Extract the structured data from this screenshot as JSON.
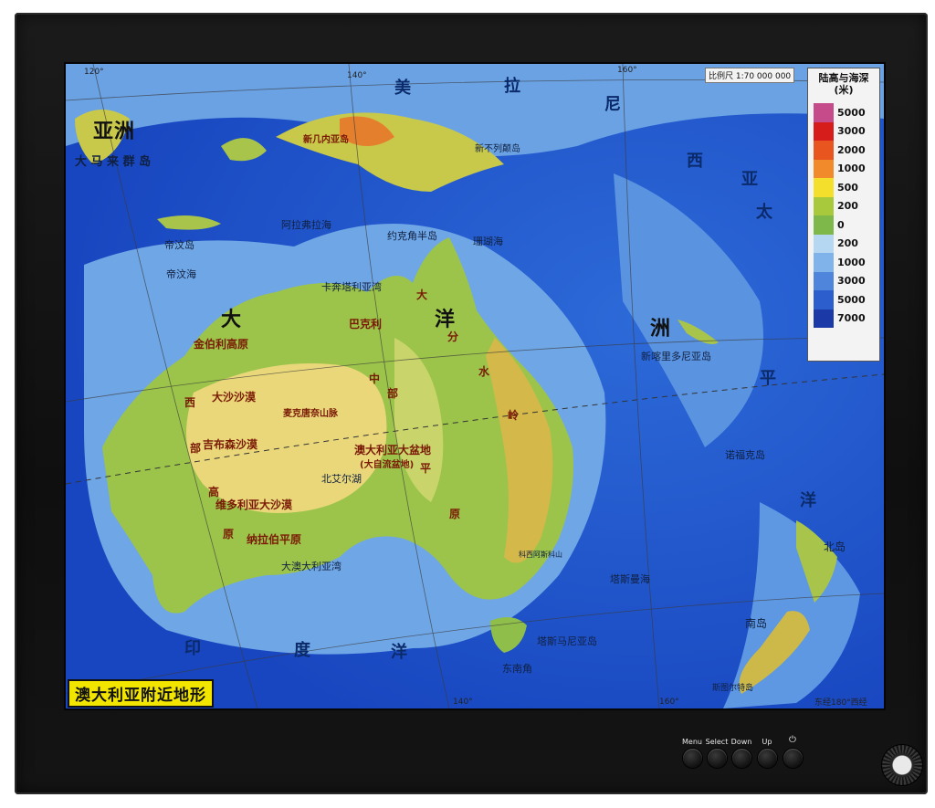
{
  "map": {
    "title": "澳大利亚附近地形",
    "scale": "比例尺 1:70 000 000",
    "footnote": "东经180°西经",
    "legend": {
      "title": "陆高与海深",
      "unit": "(米)",
      "rows": [
        {
          "value": "5000",
          "color": "#c64b8a"
        },
        {
          "value": "3000",
          "color": "#d71c1c"
        },
        {
          "value": "2000",
          "color": "#e8551e"
        },
        {
          "value": "1000",
          "color": "#f08a2a"
        },
        {
          "value": "500",
          "color": "#f5df2d"
        },
        {
          "value": "200",
          "color": "#a9c93c"
        },
        {
          "value": "0",
          "color": "#7fb84a"
        },
        {
          "value": "200",
          "color": "#b5d7f2"
        },
        {
          "value": "1000",
          "color": "#7fb3ea"
        },
        {
          "value": "3000",
          "color": "#4f86dc"
        },
        {
          "value": "5000",
          "color": "#2c5fcd"
        },
        {
          "value": "7000",
          "color": "#1b3aa8"
        }
      ]
    },
    "coords": {
      "lon120": "120°",
      "lon140": "140°",
      "lon160": "160°",
      "lon140b": "140°",
      "lon160b": "160°"
    },
    "labels": {
      "asia": "亚洲",
      "malay": "大 马 来 群 岛",
      "oceania_da": "大",
      "oceania_yang": "洋",
      "oceania_zhou": "洲",
      "america": "美",
      "la": "拉",
      "ni": "尼",
      "xi": "西",
      "ya": "亚",
      "pac_tai": "太",
      "pac_ping": "平",
      "pac_yang": "洋",
      "indian_yin": "印",
      "indian_du": "度",
      "indian_yang": "洋",
      "new_guinea": "新几内亚岛",
      "new_britain": "新不列颠岛",
      "kimberley": "金伯利高原",
      "great_sandy": "大沙沙漠",
      "west": "西",
      "bu": "部",
      "gao": "高",
      "yuan": "原",
      "gibson": "吉布森沙漠",
      "victoria_desert": "维多利亚大沙漠",
      "nullarbor": "纳拉伯平原",
      "macdonnell": "麦克唐奈山脉",
      "great_basin": "澳大利亚大盆地",
      "great_basin_sub": "(大自流盆地)",
      "central_low_1": "中",
      "central_low_2": "部",
      "central_low_3": "平",
      "central_low_4": "原",
      "divide_da": "大",
      "divide_fen": "分",
      "divide_shui": "水",
      "divide_ling": "岭",
      "barkly": "巴克利",
      "arafura": "阿拉弗拉海",
      "timor": "帝汶海",
      "timor2": "帝汶岛",
      "carpentaria": "卡奔塔利亚湾",
      "lake_eyre": "北艾尔湖",
      "great_aus_bight": "大澳大利亚湾",
      "tasmania": "塔斯马尼亚岛",
      "southeast_cape": "东南角",
      "new_caledonia": "新喀里多尼亚岛",
      "norfolk": "诺福克岛",
      "north_island": "北岛",
      "south_island": "南岛",
      "stewart": "斯图尔特岛",
      "cape_york": "约克角半岛",
      "coral_sea": "珊瑚海",
      "tasman_sea": "塔斯曼海",
      "kosciuszko": "科西阿斯科山"
    }
  },
  "controls": {
    "menu": "Menu",
    "select": "Select",
    "down": "Down",
    "up": "Up",
    "power": "⏻"
  }
}
